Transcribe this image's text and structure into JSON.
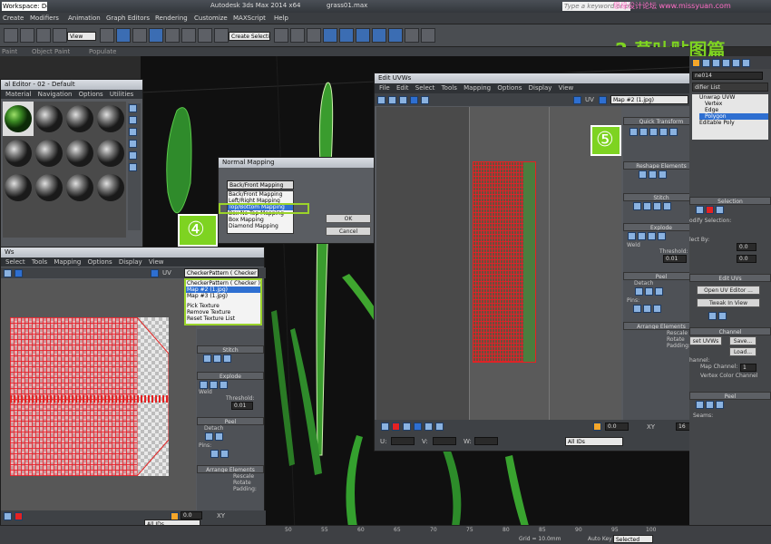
{
  "titlebar": {
    "workspace": "Workspace: Default",
    "app": "Autodesk 3ds Max  2014 x64",
    "file": "grass01.max",
    "search_placeholder": "Type a keyword or phrase"
  },
  "menubar": [
    "Create",
    "Modifiers",
    "Animation",
    "Graph Editors",
    "Rendering",
    "Customize",
    "MAXScript",
    "Help"
  ],
  "toolbar": {
    "selection_filter": "View",
    "named_selection": "Create Selection Se"
  },
  "ribbon": [
    "Paint",
    "Object Paint",
    "Populate"
  ],
  "watermark": {
    "site": "思缘设计论坛 www.missyuan.com",
    "step_title": "2.草叶贴图篇"
  },
  "material_editor": {
    "title": "al Editor - 02 - Default",
    "menu": [
      "Material",
      "Navigation",
      "Options",
      "Utilities"
    ]
  },
  "normal_mapping": {
    "title": "Normal Mapping",
    "selected": "Back/Front Mapping",
    "options": [
      "Back/Front Mapping",
      "Left/Right Mapping",
      "Top/Bottom Mapping",
      "Box No Top Mapping",
      "Box Mapping",
      "Diamond Mapping"
    ],
    "ok": "OK",
    "cancel": "Cancel"
  },
  "step_markers": {
    "step4": "④",
    "step5": "⑤"
  },
  "uvw_small": {
    "title": "Ws",
    "menu": [
      "Select",
      "Tools",
      "Mapping",
      "Options",
      "Display",
      "View"
    ],
    "uv_label": "UV",
    "texture_selected": "CheckerPattern ( Checker )",
    "texture_list": [
      "CheckerPattern ( Checker )",
      "Map #2 (1.jpg)",
      "Map #3 (1.jpg)",
      "",
      "Pick Texture",
      "Remove Texture",
      "Reset Texture List"
    ],
    "rollouts": [
      "Stitch",
      "Explode",
      "Peel",
      "Arrange Elements"
    ],
    "weld": "Weld",
    "threshold": "Threshold:",
    "threshold_value": "0.01",
    "detach": "Detach",
    "pins": "Pins:",
    "rescale": "Rescale",
    "rotate": "Rotate",
    "padding": "Padding:",
    "value_field": "0.0",
    "all_ids": "All IDs",
    "xy": "XY"
  },
  "uvw_large": {
    "title": "Edit UVWs",
    "menu": [
      "File",
      "Edit",
      "Select",
      "Tools",
      "Mapping",
      "Options",
      "Display",
      "View"
    ],
    "uv_label": "UV",
    "map_selected": "Map #2 (1.jpg)",
    "rollouts": [
      "Quick Transform",
      "Reshape Elements",
      "Stitch",
      "Explode",
      "Peel",
      "Arrange Elements"
    ],
    "weld": "Weld",
    "threshold": "Threshold:",
    "threshold_value": "0.01",
    "detach": "Detach",
    "pins": "Pins:",
    "rescale": "Rescale",
    "rotate": "Rotate",
    "padding": "Padding:",
    "u": "U:",
    "v": "V:",
    "w": "W:",
    "value_field": "0.0",
    "xy": "XY",
    "zoom_value": "16",
    "all_ids": "All IDs"
  },
  "cmd_panel": {
    "object_name": "ne014",
    "modifier_list": "difier List",
    "stack": [
      "Unwrap UVW",
      "Vertex",
      "Edge",
      "Polygon",
      "Editable Poly"
    ],
    "selection_head": "Selection",
    "modify_selection": "odify Selection:",
    "select_by": "lect By:",
    "value_field": "0.0",
    "edit_uvs": "Edit UVs",
    "open_uv_editor": "Open UV Editor ...",
    "tweak_in_view": "Tweak In View",
    "channel_head": "Channel",
    "reset_uvws": "set UVWs",
    "save": "Save...",
    "load": "Load...",
    "channel_label": "hannel:",
    "map_channel": "Map Channel:",
    "map_channel_value": "1",
    "vertex_color_channel": "Vertex Color Channel",
    "peel_head": "Peel",
    "seams": "Seams:"
  },
  "timeline": {
    "ticks": [
      "50",
      "55",
      "60",
      "65",
      "70",
      "75",
      "80",
      "85",
      "90",
      "95",
      "100"
    ]
  },
  "statusbar": {
    "grid": "Grid = 10.0mm",
    "auto_key": "Auto Key",
    "selected": "Selected"
  },
  "colors": {
    "accent_green": "#7ed321",
    "selection_red": "#e52222",
    "ui_blue": "#2e6fd1",
    "highlight_green_box": "#9bd32a"
  }
}
